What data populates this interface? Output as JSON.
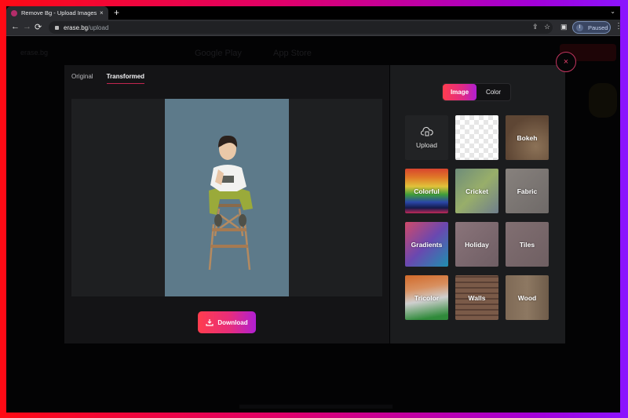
{
  "browser": {
    "tab_title": "Remove Bg - Upload Images to",
    "tab_close": "×",
    "new_tab": "+",
    "tab_menu": "⌄",
    "back": "←",
    "forward": "→",
    "reload": "⟳",
    "url_host": "erase.bg",
    "url_path": "/upload",
    "share_icon": "⇪",
    "bookmark_icon": "☆",
    "sidepanel_icon": "▣",
    "profile_initial": "I",
    "profile_status": "Paused",
    "menu_icon": "⋮"
  },
  "site": {
    "logo": "erase.bg",
    "google_play": "Google Play",
    "app_store": "App Store"
  },
  "modal": {
    "tabs": [
      {
        "label": "Original",
        "active": false
      },
      {
        "label": "Transformed",
        "active": true
      }
    ],
    "download_label": "Download",
    "close_icon": "×",
    "bg_toggle": [
      {
        "label": "Image",
        "active": true
      },
      {
        "label": "Color",
        "active": false
      }
    ],
    "backgrounds": [
      {
        "label": "Upload",
        "kind": "upload"
      },
      {
        "label": "",
        "kind": "transparent"
      },
      {
        "label": "Bokeh",
        "kind": "image",
        "color": "#6b5541"
      },
      {
        "label": "Colorful",
        "kind": "image",
        "color": "#c84a3a"
      },
      {
        "label": "Cricket",
        "kind": "image",
        "color": "#7a8f74"
      },
      {
        "label": "Fabric",
        "kind": "image",
        "color": "#7c7875"
      },
      {
        "label": "Gradients",
        "kind": "image",
        "color": "#8a5ea8"
      },
      {
        "label": "Holiday",
        "kind": "image",
        "color": "#7e6a70"
      },
      {
        "label": "Tiles",
        "kind": "image",
        "color": "#7a6a6c"
      },
      {
        "label": "Tricolor",
        "kind": "image",
        "color": "#b7826a"
      },
      {
        "label": "Walls",
        "kind": "image",
        "color": "#6f5646"
      },
      {
        "label": "Wood",
        "kind": "image",
        "color": "#7e6a58"
      }
    ]
  },
  "colors": {
    "accent_start": "#ff3d4e",
    "accent_end": "#b11fd3",
    "photo_bg": "#5d7a8a"
  }
}
